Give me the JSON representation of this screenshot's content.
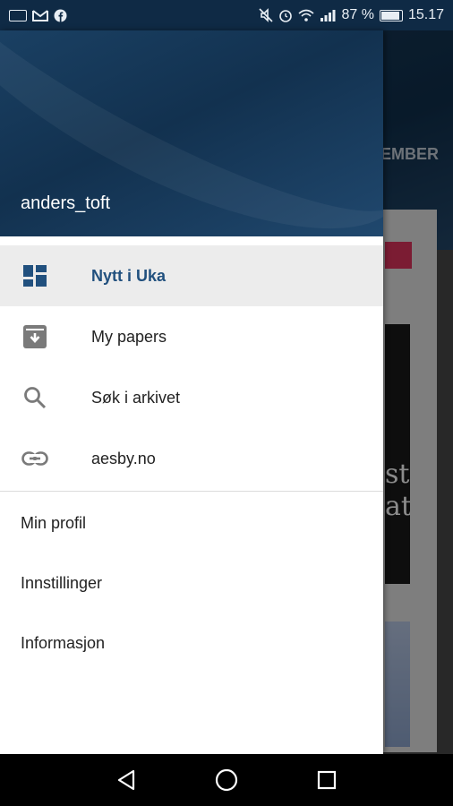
{
  "status_bar": {
    "battery_level": "87 %",
    "time": "15.17"
  },
  "background": {
    "header_fragment": "EMBER",
    "paper_fragment": "st at"
  },
  "drawer": {
    "username": "anders_toft",
    "menu_items": [
      {
        "label": "Nytt i Uka",
        "icon": "dashboard-icon",
        "active": true
      },
      {
        "label": "My papers",
        "icon": "archive-download-icon",
        "active": false
      },
      {
        "label": "Søk i arkivet",
        "icon": "search-icon",
        "active": false
      },
      {
        "label": "aesby.no",
        "icon": "link-icon",
        "active": false
      }
    ],
    "secondary_items": [
      {
        "label": "Min profil"
      },
      {
        "label": "Innstillinger"
      },
      {
        "label": "Informasjon"
      }
    ]
  },
  "colors": {
    "accent": "#21507e",
    "header_bg": "#12314f",
    "active_item_bg": "#ececec"
  }
}
